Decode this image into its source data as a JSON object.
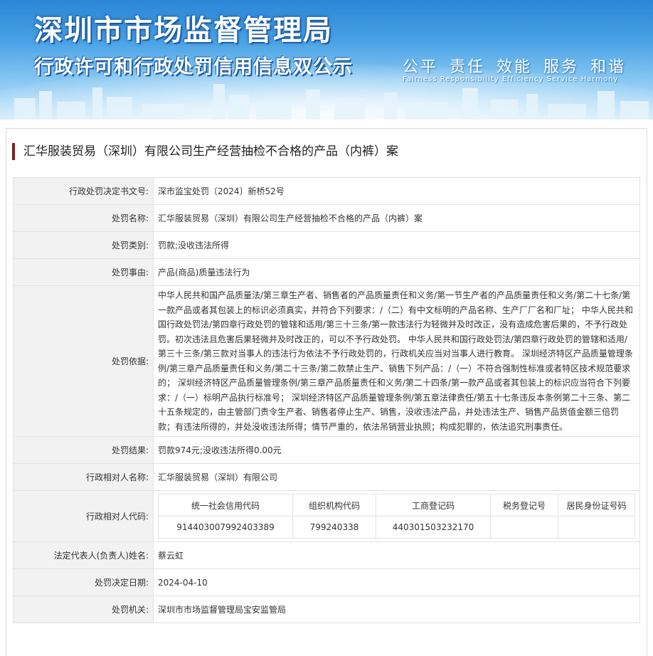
{
  "header": {
    "title": "深圳市市场监督管理局",
    "subtitle": "行政许可和行政处罚信用信息双公示",
    "slogan": "公平  责任  效能  服务  和谐",
    "slogan_en": "Fairness  Responsibility  Efficiency  Service  Harmony"
  },
  "case_title": "汇华服装贸易（深圳）有限公司生产经营抽检不合格的产品（内裤）案",
  "rows": {
    "decision_no": {
      "label": "行政处罚决定书文号:",
      "value": "深市监宝处罚〔2024〕新桥52号"
    },
    "name": {
      "label": "处罚名称:",
      "value": "汇华服装贸易（深圳）有限公司生产经营抽检不合格的产品（内裤）案"
    },
    "category": {
      "label": "处罚类别:",
      "value": "罚款;没收违法所得"
    },
    "reason": {
      "label": "处罚事由:",
      "value": "产品(商品)质量违法行为"
    },
    "basis": {
      "label": "处罚依据:",
      "value": "中华人民共和国产品质量法/第三章生产者、销售者的产品质量责任和义务/第一节生产者的产品质量责任和义务/第二十七条/第一款产品或者其包装上的标识必须真实，并符合下列要求：/（二）有中文标明的产品名称、生产厂厂名和厂址； 中华人民共和国行政处罚法/第四章行政处罚的管辖和适用/第三十三条/第一款违法行为轻微并及时改正，没有造成危害后果的，不予行政处罚。初次违法且危害后果轻微并及时改正的，可以不予行政处罚。 中华人民共和国行政处罚法/第四章行政处罚的管辖和适用/第三十三条/第三款对当事人的违法行为依法不予行政处罚的，行政机关应当对当事人进行教育。 深圳经济特区产品质量管理条例/第三章产品质量责任和义务/第二十三条/第二款禁止生产、销售下列产品：/（一）不符合强制性标准或者特区技术规范要求的； 深圳经济特区产品质量管理条例/第三章产品质量责任和义务/第二十四条/第一款产品或者其包装上的标识应当符合下列要求：/（一）标明产品执行标准号； 深圳经济特区产品质量管理条例/第五章法律责任/第五十七条违反本条例第二十三条、第二十五条规定的，由主管部门责令生产者、销售者停止生产、销售，没收违法产品，并处违法生产、销售产品货值金额三倍罚款；有违法所得的，并处没收违法所得；情节严重的，依法吊销营业执照；构成犯罪的，依法追究刑事责任。"
    },
    "result": {
      "label": "处罚结果:",
      "value": "罚款974元;没收违法所得0.00元"
    },
    "party_name": {
      "label": "行政相对人名称:",
      "value": "汇华服装贸易（深圳）有限公司"
    },
    "party_code": {
      "label": "行政相对人代码:",
      "headers": [
        "统一社会信用代码",
        "组织机构代码",
        "工商登记码",
        "税务登记号",
        "居民身份证号码"
      ],
      "values": [
        "914403007992403389",
        "799240338",
        "440301503232170",
        "",
        ""
      ]
    },
    "legal_rep": {
      "label": "法定代表人(负责人)姓名:",
      "value": "蔡云虹"
    },
    "date": {
      "label": "处罚决定日期:",
      "value": "2024-04-10"
    },
    "authority": {
      "label": "处罚机关:",
      "value": "深圳市市场监督管理局宝安监管局"
    }
  },
  "colors": {
    "title_bar": "#8b1a1a",
    "label_bg": "#f2f2f2",
    "border": "#e2e2e2",
    "banner_top": "#2a86d6"
  }
}
